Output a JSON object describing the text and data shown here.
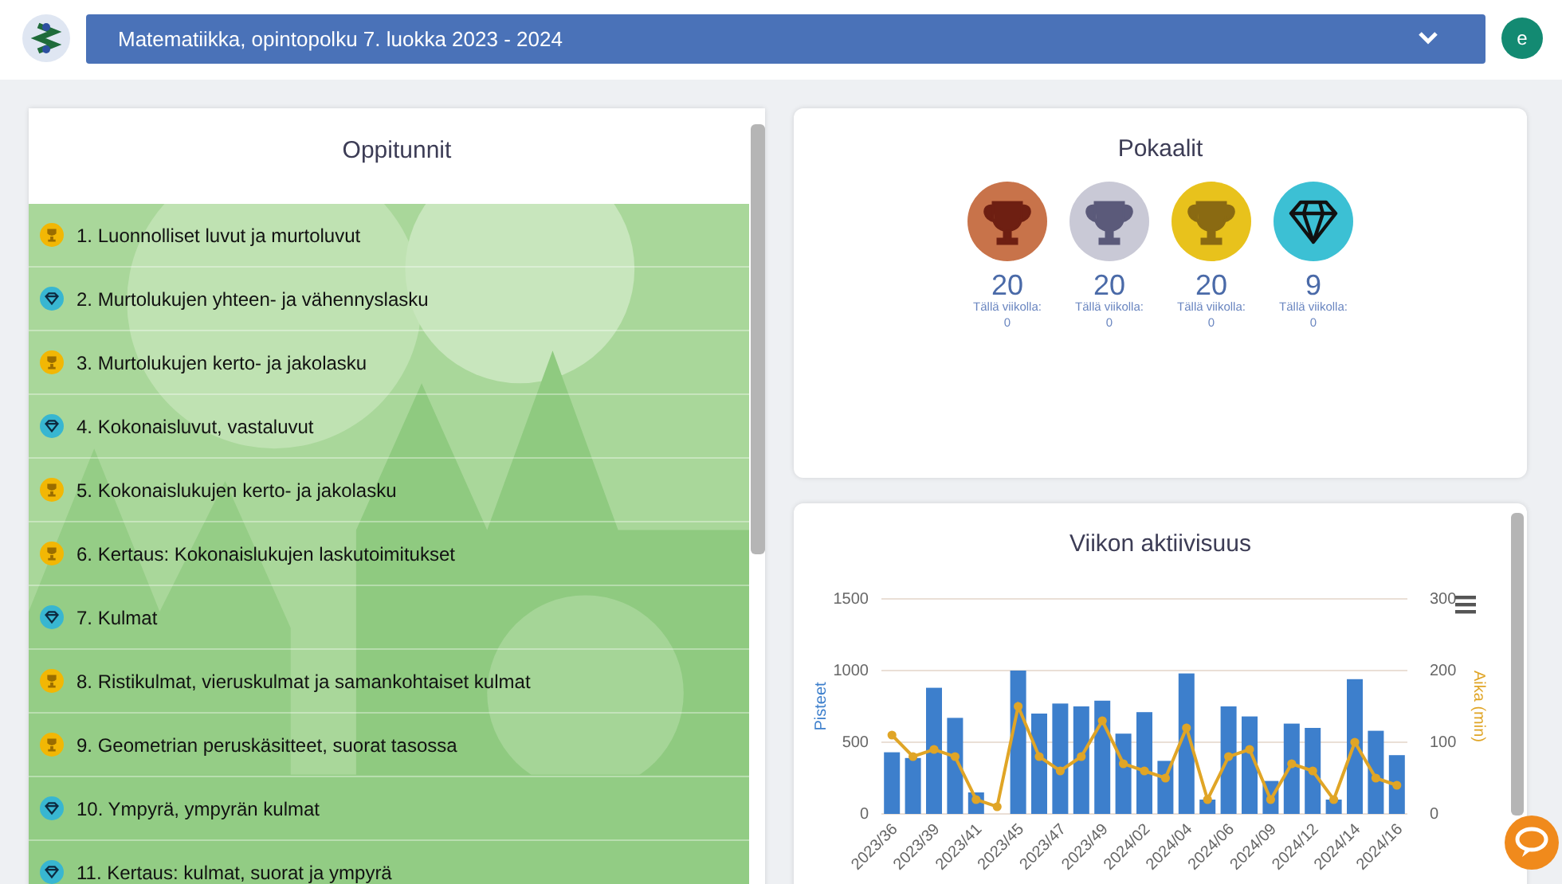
{
  "header": {
    "course": "Matematiikka, opintopolku 7. luokka 2023 - 2024",
    "avatar": "e"
  },
  "lessons": {
    "title": "Oppitunnit",
    "items": [
      {
        "kind": "trophy",
        "label": "1. Luonnolliset luvut ja murtoluvut"
      },
      {
        "kind": "diamond",
        "label": "2. Murtolukujen yhteen- ja vähennyslasku"
      },
      {
        "kind": "trophy",
        "label": "3. Murtolukujen kerto- ja jakolasku"
      },
      {
        "kind": "diamond",
        "label": "4. Kokonaisluvut, vastaluvut"
      },
      {
        "kind": "trophy",
        "label": "5. Kokonaislukujen kerto- ja jakolasku"
      },
      {
        "kind": "trophy",
        "label": "6. Kertaus: Kokonaislukujen laskutoimitukset"
      },
      {
        "kind": "diamond",
        "label": "7. Kulmat"
      },
      {
        "kind": "trophy",
        "label": "8. Ristikulmat, vieruskulmat ja samankohtaiset kulmat"
      },
      {
        "kind": "trophy",
        "label": "9. Geometrian peruskäsitteet, suorat tasossa"
      },
      {
        "kind": "diamond",
        "label": "10. Ympyrä, ympyrän kulmat"
      },
      {
        "kind": "diamond",
        "label": "11. Kertaus: kulmat, suorat ja ympyrä"
      }
    ]
  },
  "trophies": {
    "title": "Pokaalit",
    "items": [
      {
        "kind": "bronze",
        "count": "20",
        "week_label": "Tällä viikolla:",
        "week_count": "0"
      },
      {
        "kind": "silver",
        "count": "20",
        "week_label": "Tällä viikolla:",
        "week_count": "0"
      },
      {
        "kind": "gold",
        "count": "20",
        "week_label": "Tällä viikolla:",
        "week_count": "0"
      },
      {
        "kind": "diamond",
        "count": "9",
        "week_label": "Tällä viikolla:",
        "week_count": "0"
      }
    ]
  },
  "activity": {
    "title": "Viikon aktiivisuus",
    "chart_data": {
      "type": "bar",
      "ylim": [
        0,
        1500
      ],
      "yticks": [
        0,
        500,
        1000,
        1500
      ],
      "y2lim": [
        0,
        300
      ],
      "y2ticks": [
        0,
        100,
        200,
        300
      ],
      "categories": [
        "2023/36",
        null,
        "2023/39",
        null,
        "2023/41",
        null,
        "2023/45",
        null,
        "2023/47",
        null,
        "2023/49",
        null,
        "2024/02",
        null,
        "2024/04",
        null,
        "2024/06",
        null,
        "2024/09",
        null,
        "2024/12",
        null,
        "2024/14",
        null,
        "2024/16"
      ],
      "series": [
        {
          "name": "Pisteet",
          "type": "bar",
          "color": "#3d7fcc",
          "values": [
            430,
            390,
            880,
            670,
            150,
            0,
            1000,
            700,
            770,
            750,
            790,
            560,
            710,
            370,
            980,
            100,
            750,
            680,
            230,
            630,
            600,
            100,
            940,
            580,
            410
          ]
        },
        {
          "name": "Aika (min)",
          "type": "line",
          "axis": "y2",
          "marker": "circle",
          "color": "#e0a526",
          "values": [
            110,
            80,
            90,
            80,
            20,
            10,
            150,
            80,
            60,
            80,
            130,
            70,
            60,
            50,
            120,
            20,
            80,
            90,
            20,
            70,
            60,
            20,
            100,
            50,
            40
          ]
        }
      ]
    }
  }
}
